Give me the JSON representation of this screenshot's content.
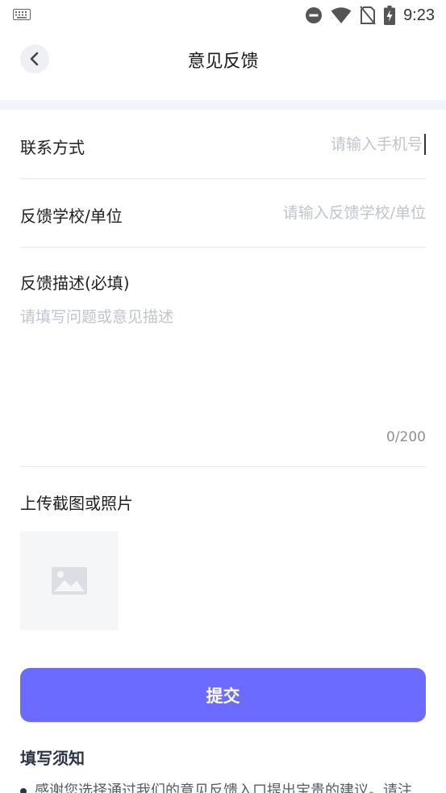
{
  "status_bar": {
    "time": "9:23",
    "icons": [
      "keyboard-icon",
      "do-not-disturb-icon",
      "wifi-icon",
      "no-sim-icon",
      "battery-charging-icon"
    ]
  },
  "header": {
    "title": "意见反馈",
    "back_icon": "chevron-left-icon"
  },
  "form": {
    "contact": {
      "label": "联系方式",
      "placeholder": "请输入手机号",
      "value": ""
    },
    "school": {
      "label": "反馈学校/单位",
      "placeholder": "请输入反馈学校/单位",
      "value": ""
    },
    "description": {
      "label": "反馈描述(必填)",
      "placeholder": "请填写问题或意见描述",
      "value": "",
      "counter": "0/200"
    },
    "upload": {
      "label": "上传截图或照片",
      "icon": "image-placeholder-icon"
    }
  },
  "submit_label": "提交",
  "notice": {
    "title": "填写须知",
    "items": [
      "感谢您选择通过我们的意见反馈入口提出宝贵的建议。请注"
    ]
  },
  "colors": {
    "accent": "#6b6bff",
    "placeholder": "#c0c4cc",
    "divider_band": "#f2f4fb"
  }
}
